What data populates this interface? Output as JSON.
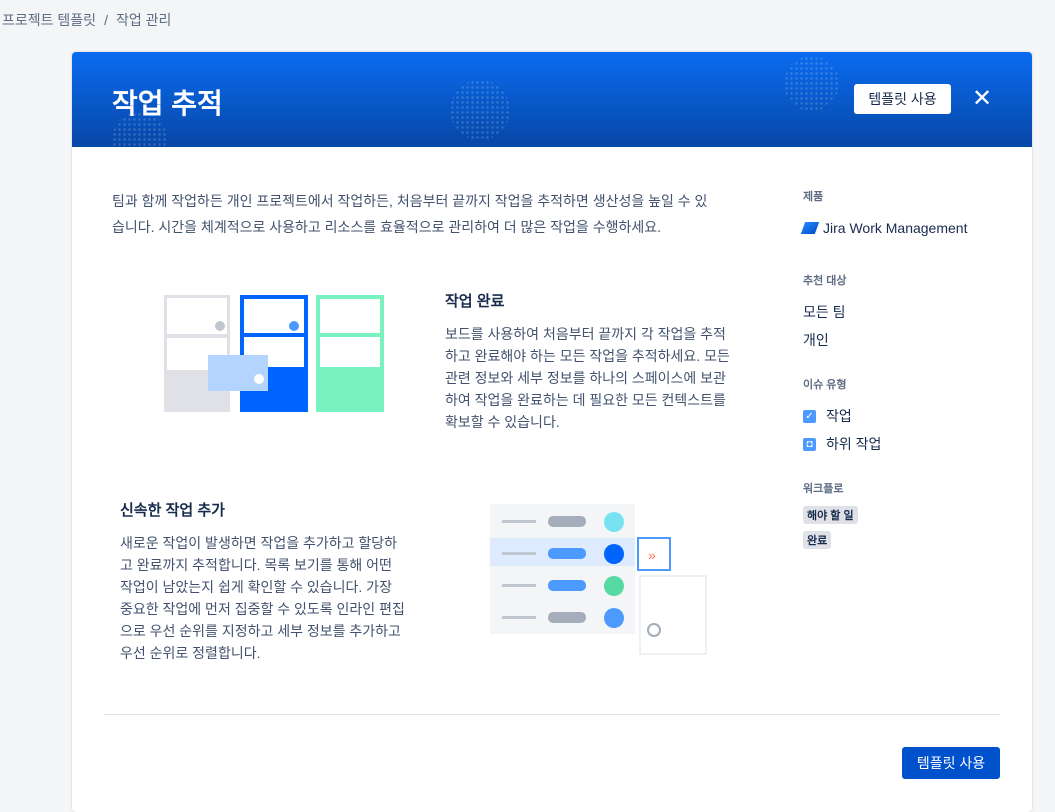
{
  "breadcrumb": [
    "프로젝트 템플릿",
    "/",
    "작업 관리"
  ],
  "header": {
    "title": "작업 추적",
    "use_template": "템플릿 사용",
    "close": "✕"
  },
  "intro": [
    "팀과 함께 작업하든 개인 프로젝트에서 작업하든, 처음부터 끝까지 작업을 추적하면 생산성을 높일 수 있",
    "습니다. 시간을 체계적으로 사용하고 리소스를 효율적으로 관리하여 더 많은 작업을 수행하세요."
  ],
  "section1": {
    "title": "작업 완료",
    "lines": [
      "보드를 사용하여 처음부터 끝까지 각 작업을 추적",
      "하고 완료해야 하는 모든 작업을 추적하세요. 모든",
      "관련 정보와 세부 정보를 하나의 스페이스에 보관",
      "하여 작업을 완료하는 데 필요한 모든 컨텍스트를",
      "확보할 수 있습니다."
    ]
  },
  "section2": {
    "title": "신속한 작업 추가",
    "lines": [
      "새로운 작업이 발생하면 작업을 추가하고 할당하",
      "고 완료까지 추적합니다. 목록 보기를 통해 어떤",
      "작업이 남았는지 쉽게 확인할 수 있습니다. 가장",
      "중요한 작업에 먼저 집중할 수 있도록 인라인 편집",
      "으로 우선 순위를 지정하고 세부 정보를 추가하고",
      "우선 순위로 정렬합니다."
    ]
  },
  "sidebar": {
    "product_label": "제품",
    "product": "Jira Work Management",
    "recommended_label": "추천 대상",
    "recommended": [
      "모든 팀",
      "개인"
    ],
    "issue_types_label": "이슈 유형",
    "issue_types": [
      "작업",
      "하위 작업"
    ],
    "workflow_label": "워크플로",
    "workflow": [
      "해야 할 일",
      "완료"
    ]
  },
  "footer": {
    "use_template": "템플릿 사용"
  },
  "colors": {
    "primary": "#0052cc",
    "header_top": "#0a6cf0",
    "header_bottom": "#0747a6"
  }
}
